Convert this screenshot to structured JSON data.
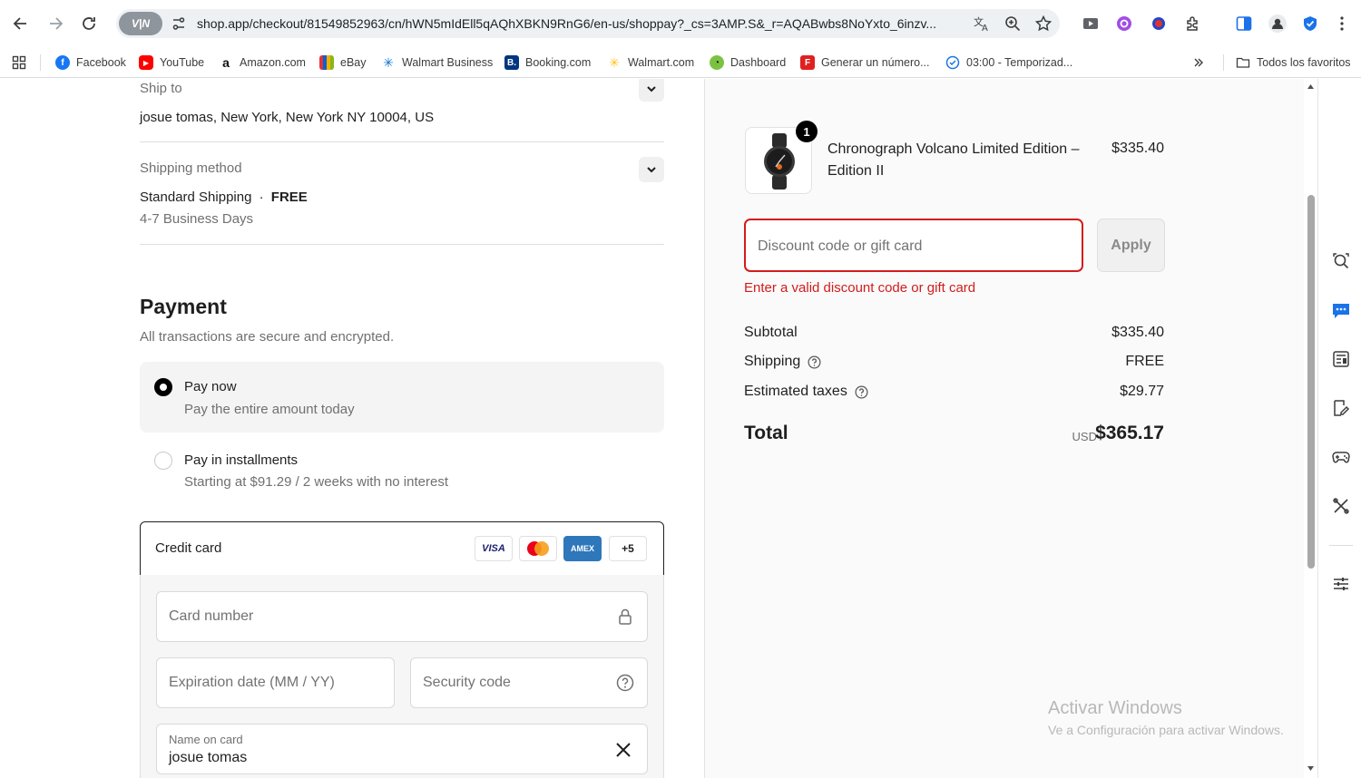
{
  "browser": {
    "url": "shop.app/checkout/81549852963/cn/hWN5mIdEll5qAQhXBKN9RnG6/en-us/shoppay?_cs=3AMP.S&_r=AQABwbs8NoYxto_6inzv...",
    "vpn_label": "V|N",
    "bookmarks": [
      {
        "label": "Facebook",
        "icon": "facebook-icon"
      },
      {
        "label": "YouTube",
        "icon": "youtube-icon"
      },
      {
        "label": "Amazon.com",
        "icon": "amazon-icon"
      },
      {
        "label": "eBay",
        "icon": "ebay-icon"
      },
      {
        "label": "Walmart Business",
        "icon": "walmart-spark-icon"
      },
      {
        "label": "Booking.com",
        "icon": "booking-icon"
      },
      {
        "label": "Walmart.com",
        "icon": "walmart-spark-icon"
      },
      {
        "label": "Dashboard",
        "icon": "dashboard-icon"
      },
      {
        "label": "Generar un número...",
        "icon": "f-icon"
      },
      {
        "label": "03:00 - Temporizad...",
        "icon": "timer-icon"
      }
    ],
    "all_bookmarks_label": "Todos los favoritos"
  },
  "checkout": {
    "ship_to": {
      "label": "Ship to",
      "value": "josue tomas, New York, New York NY 10004, US"
    },
    "shipping_method": {
      "label": "Shipping method",
      "value": "Standard Shipping",
      "separator": "·",
      "price": "FREE",
      "eta": "4-7 Business Days"
    },
    "payment": {
      "title": "Payment",
      "subtitle": "All transactions are secure and encrypted.",
      "pay_now": {
        "title": "Pay now",
        "desc": "Pay the entire amount today"
      },
      "installments": {
        "title": "Pay in installments",
        "desc": "Starting at $91.29 / 2 weeks with no interest"
      },
      "credit_card": {
        "title": "Credit card",
        "logos": [
          "VISA",
          "",
          "AMEX",
          "+5"
        ],
        "card_number_placeholder": "Card number",
        "expiration_placeholder": "Expiration date (MM / YY)",
        "security_placeholder": "Security code",
        "name_label": "Name on card",
        "name_value": "josue tomas"
      }
    }
  },
  "summary": {
    "product": {
      "name": "Chronograph Volcano Limited Edition – Edition II",
      "price": "$335.40",
      "quantity": "1"
    },
    "discount": {
      "placeholder": "Discount code or gift card",
      "apply_label": "Apply",
      "error": "Enter a valid discount code or gift card"
    },
    "rows": [
      {
        "label": "Subtotal",
        "value": "$335.40",
        "help": false
      },
      {
        "label": "Shipping",
        "value": "FREE",
        "help": true
      },
      {
        "label": "Estimated taxes",
        "value": "$29.77",
        "help": true
      }
    ],
    "total": {
      "label": "Total",
      "currency": "USD",
      "value": "$365.17"
    }
  },
  "windows_watermark": {
    "line1": "Activar Windows",
    "line2": "Ve a Configuración para activar Windows."
  },
  "colors": {
    "error": "#d21c1c",
    "accent_black": "#000000",
    "amex_blue": "#2e77bb"
  }
}
